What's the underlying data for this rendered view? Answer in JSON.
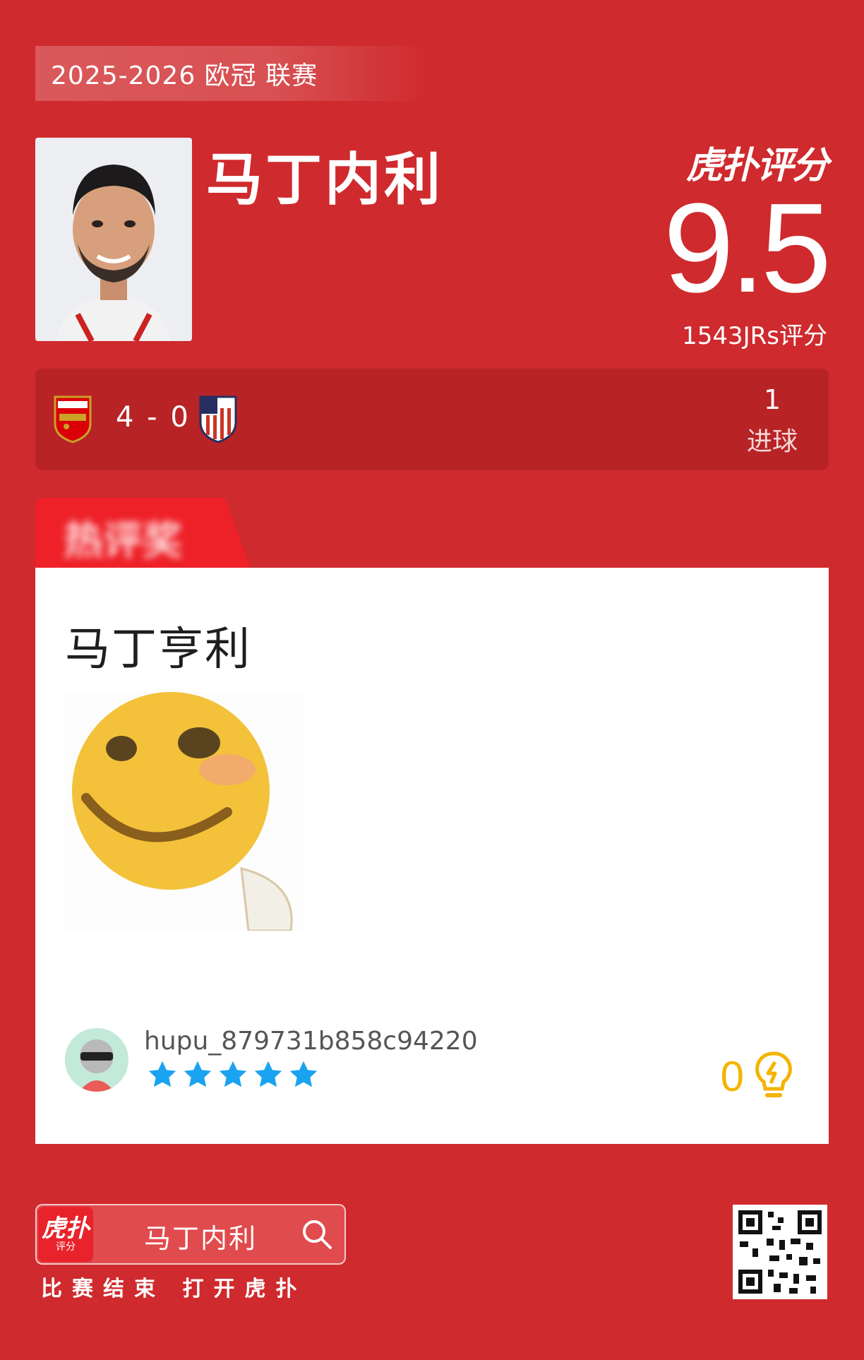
{
  "header": {
    "league": "2025-2026 欧冠 联赛",
    "player_name": "马丁内利",
    "brand": "虎扑评分",
    "rating": "9.5",
    "raters": "1543JRs评分"
  },
  "match": {
    "home_team": "Arsenal",
    "score": "4 - 0",
    "away_team": "Atletico Madrid",
    "stat_value": "1",
    "stat_label": "进球"
  },
  "tab": {
    "label": "热评奖"
  },
  "comment": {
    "text": "马丁亨利",
    "username": "hupu_879731b858c94220",
    "stars": 5,
    "likes": "0",
    "colors": {
      "star": "#1aa3f0",
      "like": "#f4b400"
    }
  },
  "footer": {
    "app_icon_main": "虎扑",
    "app_icon_sub": "评分",
    "search_text": "马丁内利",
    "cta": "比赛结束 打开虎扑"
  },
  "colors": {
    "background": "#cf2a2d",
    "card": "#b82326",
    "tab": "#ee2028"
  }
}
